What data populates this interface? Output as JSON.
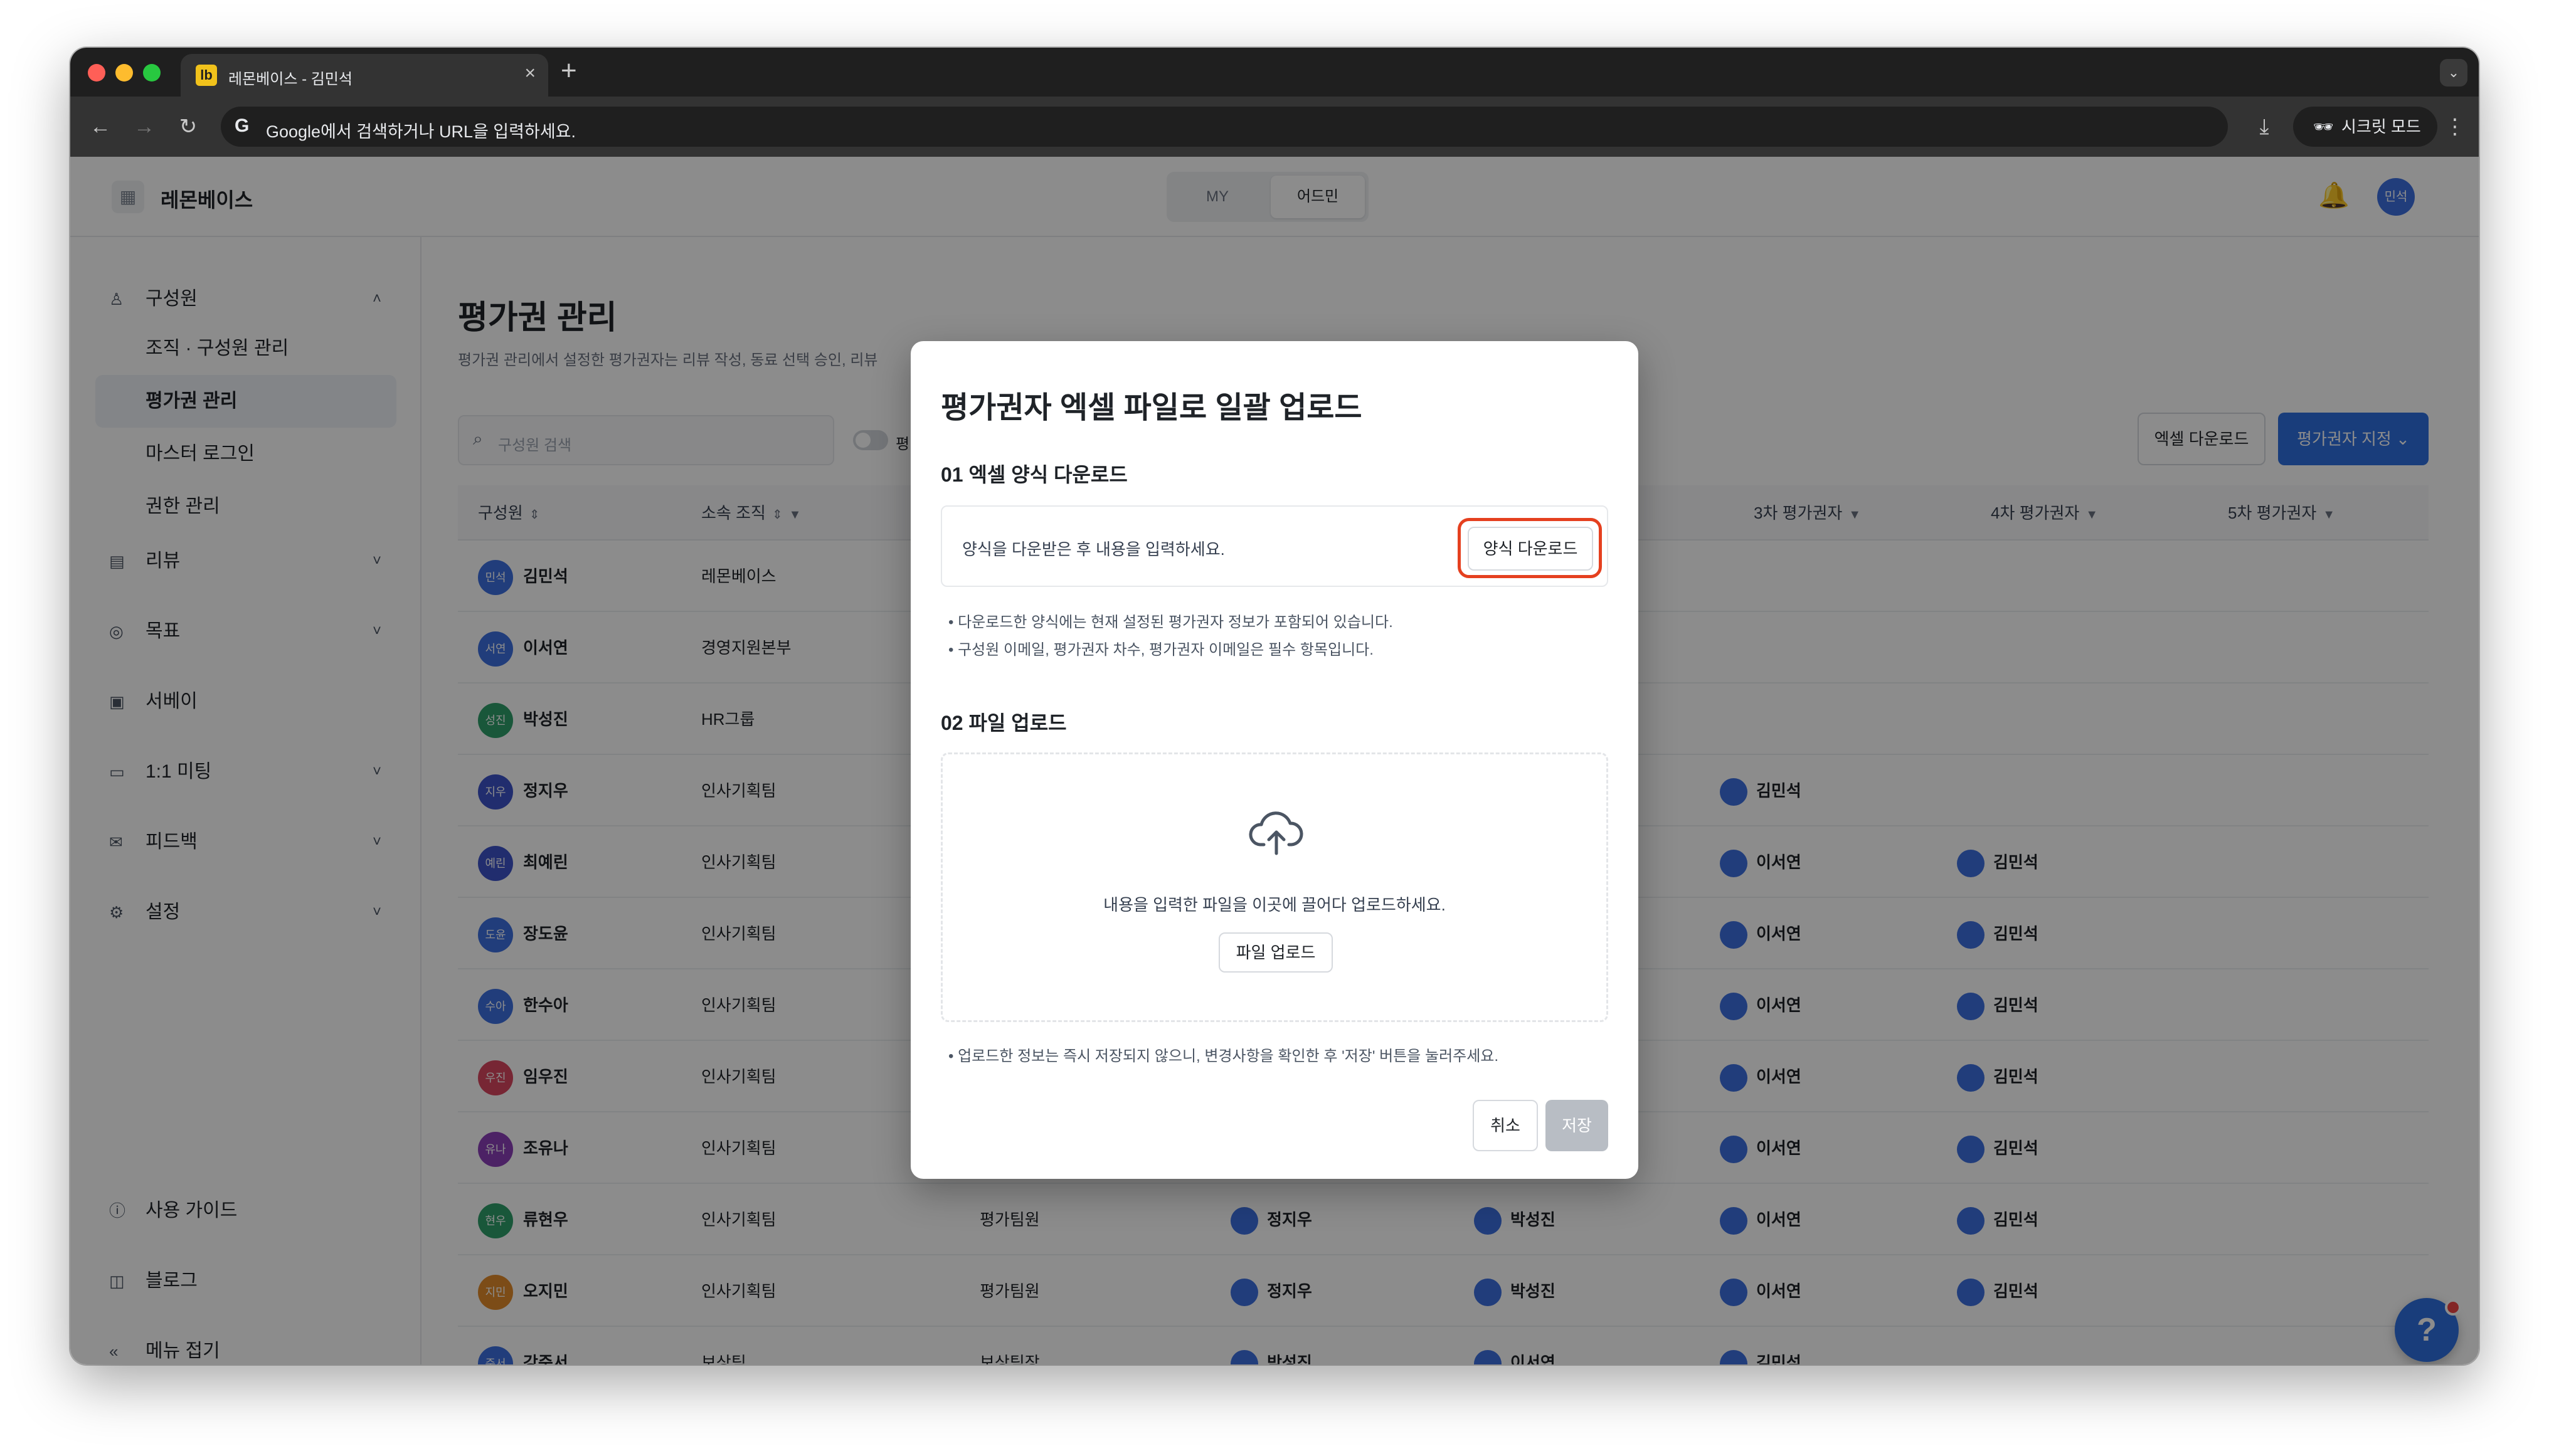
{
  "browser": {
    "tab_title": "레몬베이스 - 김민석",
    "tab_favicon": "lb",
    "new_tab": "+",
    "omnibox_text": "Google에서 검색하거나 URL을 입력하세요.",
    "incognito_label": "시크릿 모드"
  },
  "header": {
    "brand": "레몬베이스",
    "mode_my": "MY",
    "mode_admin": "어드민",
    "avatar_label": "민석"
  },
  "sidebar": {
    "items": [
      {
        "label": "구성원",
        "icon": "user-icon",
        "chevron": "˄"
      },
      {
        "label": "조직 · 구성원 관리"
      },
      {
        "label": "평가권 관리"
      },
      {
        "label": "마스터 로그인"
      },
      {
        "label": "권한 관리"
      },
      {
        "label": "리뷰",
        "icon": "document-icon",
        "chevron": "˅"
      },
      {
        "label": "목표",
        "icon": "target-icon",
        "chevron": "˅"
      },
      {
        "label": "서베이",
        "icon": "survey-icon"
      },
      {
        "label": "1:1 미팅",
        "icon": "calendar-icon",
        "chevron": "˅"
      },
      {
        "label": "피드백",
        "icon": "mail-icon",
        "chevron": "˅"
      },
      {
        "label": "설정",
        "icon": "gear-icon",
        "chevron": "˅"
      }
    ],
    "bottom": [
      {
        "label": "사용 가이드",
        "icon": "help-circle-icon"
      },
      {
        "label": "블로그",
        "icon": "book-icon"
      },
      {
        "label": "메뉴 접기",
        "icon": "collapse-icon"
      }
    ]
  },
  "main": {
    "title": "평가권 관리",
    "description": "평가권 관리에서 설정한 평가권자는 리뷰 작성, 동료 선택 승인, 리뷰",
    "search_placeholder": "구성원 검색",
    "toggle_label": "평",
    "excel_download_button": "엑셀 다운로드",
    "assign_button": "평가권자 지정",
    "columns": [
      "구성원",
      "소속 조직",
      "3차 평가권자",
      "4차 평가권자",
      "5차 평가권자"
    ],
    "rows": [
      {
        "name": "김민석",
        "avatar": "민석",
        "org": "레몬베이스",
        "color": "#3d6fe0",
        "col_c": "",
        "col_d": "",
        "col_e": "",
        "col_f": "",
        "col_g": ""
      },
      {
        "name": "이서연",
        "avatar": "서연",
        "org": "경영지원본부",
        "color": "#3d6fe0",
        "col_c": "",
        "col_d": "",
        "col_e": "",
        "col_f": "",
        "col_g": ""
      },
      {
        "name": "박성진",
        "avatar": "성진",
        "org": "HR그룹",
        "color": "#2e9e6a",
        "col_c": "",
        "col_d": "",
        "col_e": "",
        "col_f": "",
        "col_g": ""
      },
      {
        "name": "정지우",
        "avatar": "지우",
        "org": "인사기획팀",
        "color": "#3d52c8",
        "col_c": "",
        "col_d": "",
        "col_e": "",
        "col_f": "김민석",
        "col_g": ""
      },
      {
        "name": "최예린",
        "avatar": "예린",
        "org": "인사기획팀",
        "color": "#3d52c8",
        "col_c": "",
        "col_d": "",
        "col_e": "",
        "col_f": "이서연",
        "col_g": "김민석"
      },
      {
        "name": "장도윤",
        "avatar": "도윤",
        "org": "인사기획팀",
        "color": "#3d6fe0",
        "col_c": "",
        "col_d": "",
        "col_e": "",
        "col_f": "이서연",
        "col_g": "김민석"
      },
      {
        "name": "한수아",
        "avatar": "수아",
        "org": "인사기획팀",
        "color": "#3d6fe0",
        "col_c": "",
        "col_d": "",
        "col_e": "",
        "col_f": "이서연",
        "col_g": "김민석"
      },
      {
        "name": "임우진",
        "avatar": "우진",
        "org": "인사기획팀",
        "color": "#d9465f",
        "col_c": "",
        "col_d": "",
        "col_e": "",
        "col_f": "이서연",
        "col_g": "김민석"
      },
      {
        "name": "조유나",
        "avatar": "유나",
        "org": "인사기획팀",
        "color": "#8a3fb8",
        "col_c": "",
        "col_d": "",
        "col_e": "",
        "col_f": "이서연",
        "col_g": "김민석"
      },
      {
        "name": "류현우",
        "avatar": "현우",
        "org": "인사기획팀",
        "color": "#2e9e6a",
        "col_c": "평가팀원",
        "col_d": "정지우",
        "col_e": "박성진",
        "col_f": "이서연",
        "col_g": "김민석"
      },
      {
        "name": "오지민",
        "avatar": "지민",
        "org": "인사기획팀",
        "color": "#e28a2b",
        "col_c": "평가팀원",
        "col_d": "정지우",
        "col_e": "박성진",
        "col_f": "이서연",
        "col_g": "김민석"
      },
      {
        "name": "강준서",
        "avatar": "준서",
        "org": "보상팀",
        "color": "#3d6fe0",
        "col_c": "보상팀장",
        "col_d": "박성진",
        "col_e": "이서연",
        "col_f": "김민석",
        "col_g": ""
      }
    ]
  },
  "modal": {
    "title": "평가권자 엑셀 파일로 일괄 업로드",
    "section1": "01 엑셀 양식 다운로드",
    "download_hint": "양식을 다운받은 후 내용을 입력하세요.",
    "download_button": "양식 다운로드",
    "notes1": [
      "다운로드한 양식에는 현재 설정된 평가권자 정보가 포함되어 있습니다.",
      "구성원 이메일, 평가권자 차수, 평가권자 이메일은 필수 항목입니다."
    ],
    "section2": "02 파일 업로드",
    "drop_text": "내용을 입력한 파일을 이곳에 끌어다 업로드하세요.",
    "upload_button": "파일 업로드",
    "note2": "업로드한 정보는 즉시 저장되지 않으니, 변경사항을 확인한 후 '저장' 버튼을 눌러주세요.",
    "cancel_button": "취소",
    "save_button": "저장"
  },
  "colors": {
    "accent": "#2f6fe0",
    "highlight": "#e5401f",
    "disabled": "#b8bdc4"
  }
}
